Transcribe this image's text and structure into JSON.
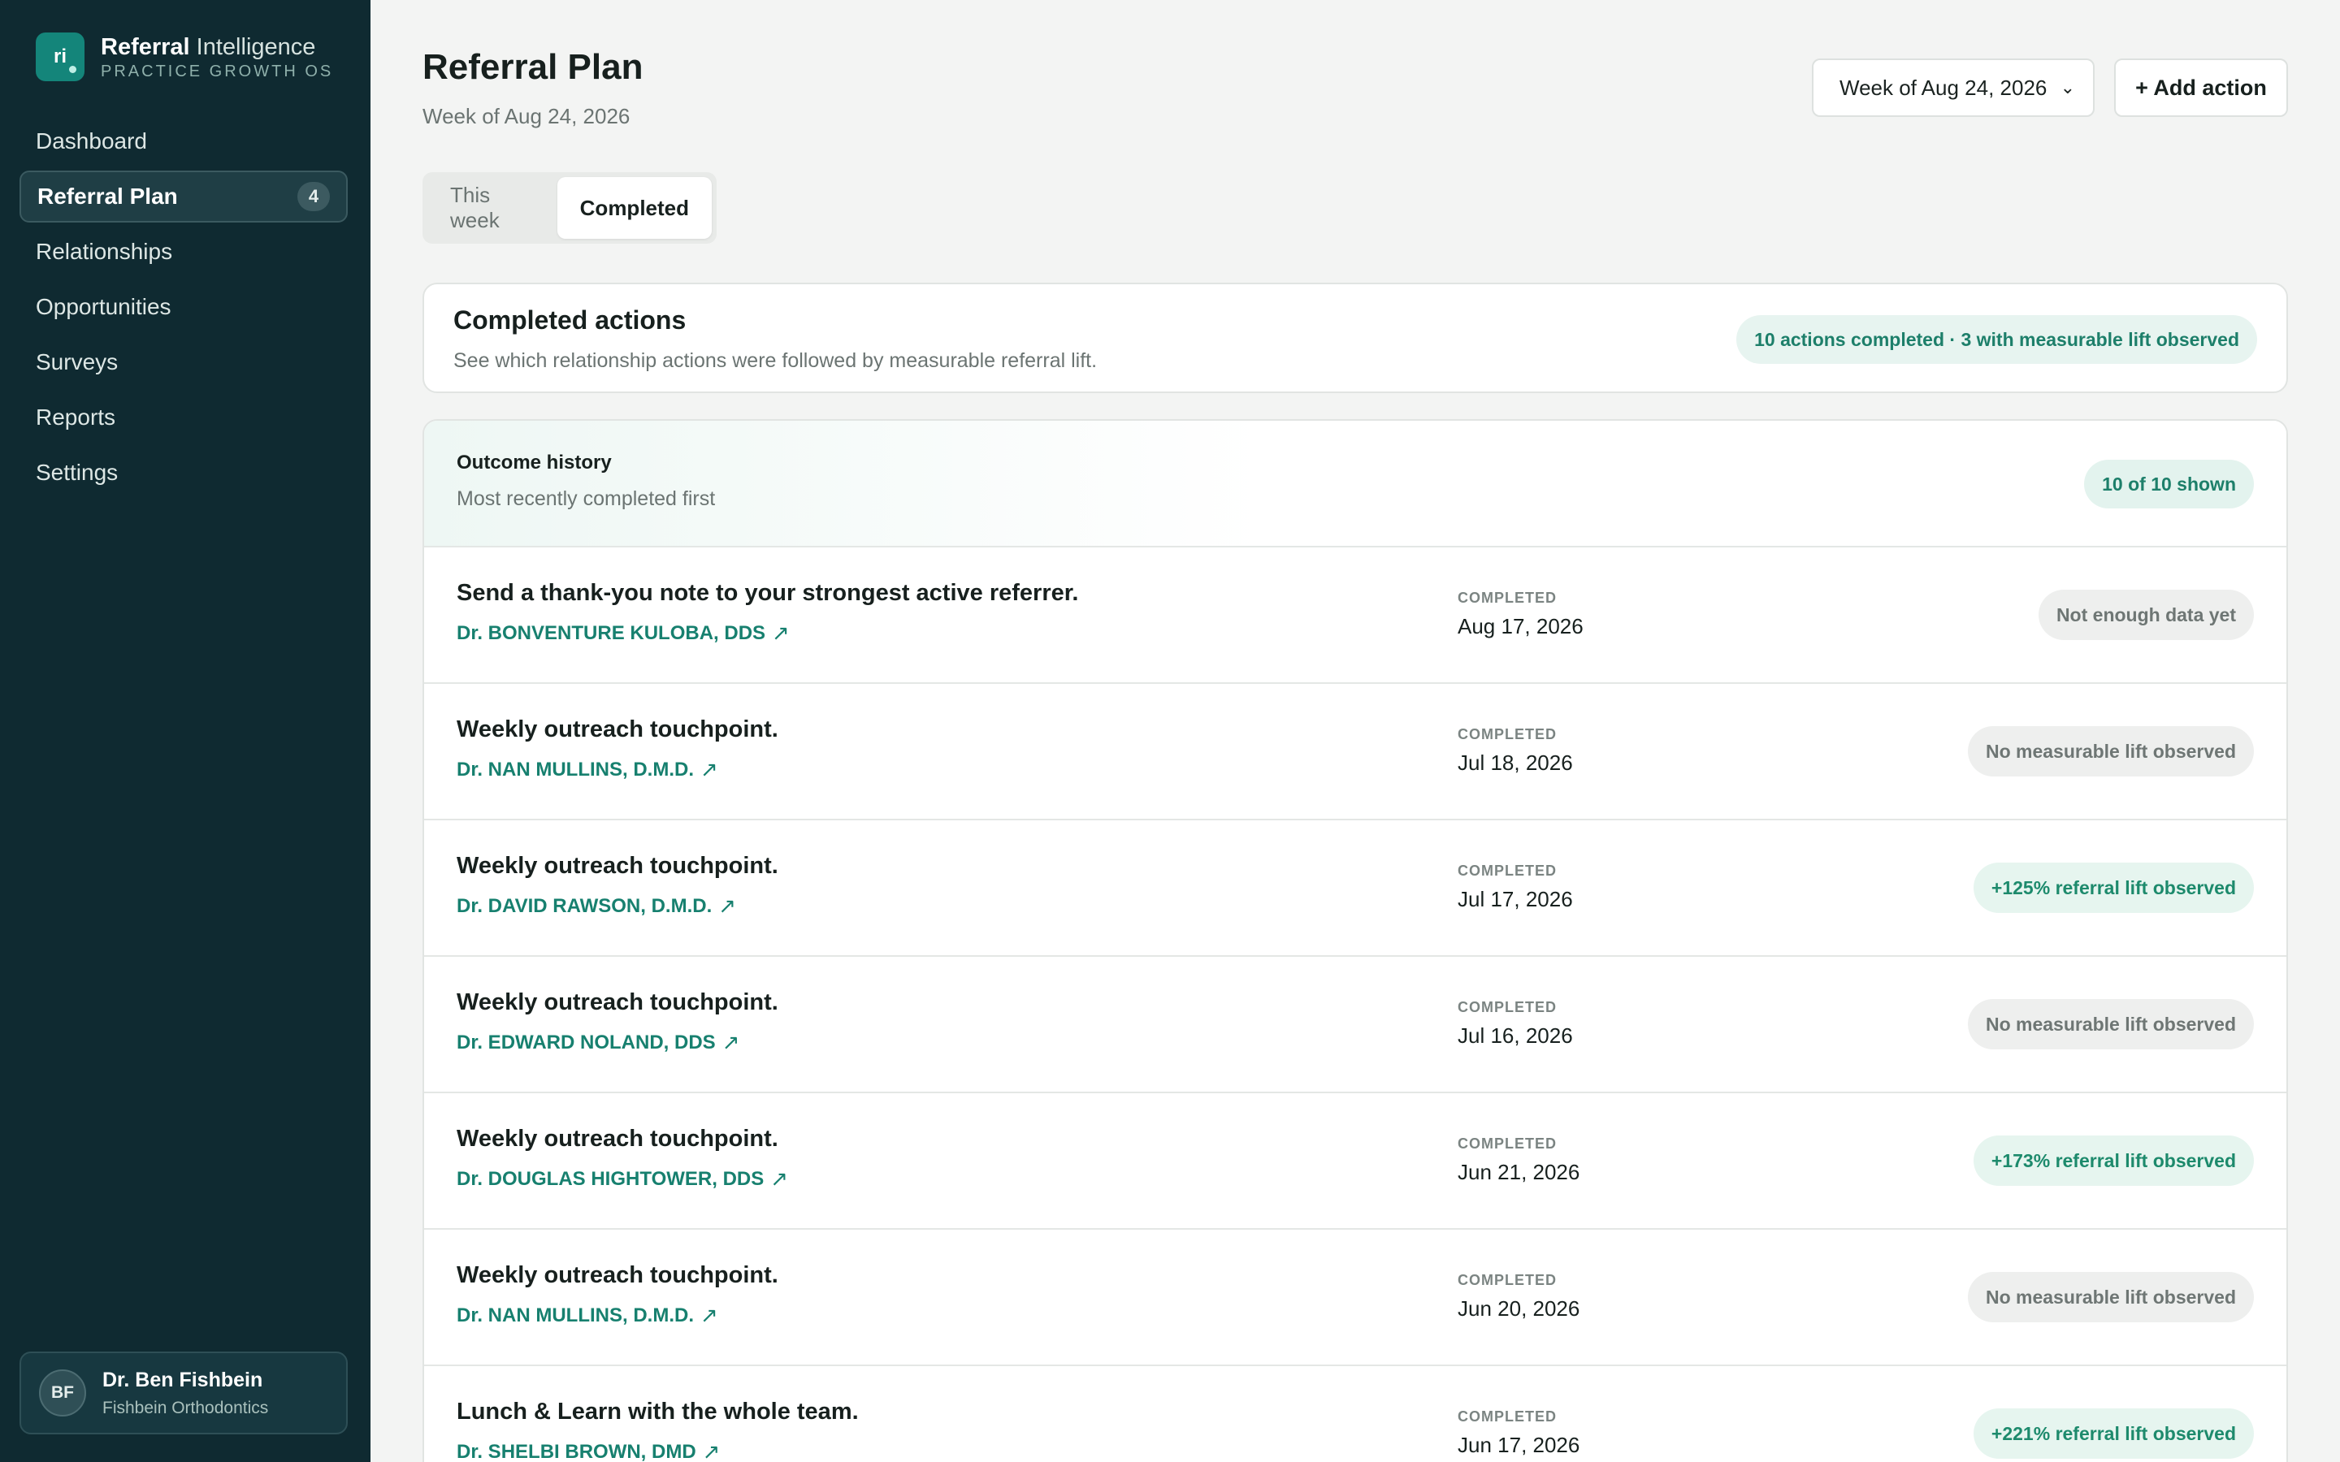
{
  "brand": {
    "logo_text": "ri",
    "name_bold": "Referral",
    "name_rest": " Intelligence",
    "tagline": "PRACTICE GROWTH OS"
  },
  "nav": [
    {
      "label": "Dashboard",
      "active": false
    },
    {
      "label": "Referral Plan",
      "active": true,
      "badge": "4"
    },
    {
      "label": "Relationships",
      "active": false
    },
    {
      "label": "Opportunities",
      "active": false
    },
    {
      "label": "Surveys",
      "active": false
    },
    {
      "label": "Reports",
      "active": false
    },
    {
      "label": "Settings",
      "active": false
    }
  ],
  "user": {
    "initials": "BF",
    "name": "Dr. Ben Fishbein",
    "org": "Fishbein Orthodontics"
  },
  "header": {
    "title": "Referral Plan",
    "subtitle": "Week of Aug 24, 2026",
    "week_select": "Week of Aug 24, 2026",
    "add_action": "+ Add action"
  },
  "tabs": [
    {
      "label": "This week",
      "active": false
    },
    {
      "label": "Completed",
      "active": true
    }
  ],
  "summary": {
    "title": "Completed actions",
    "description": "See which relationship actions were followed by measurable referral lift.",
    "pill": "10 actions completed · 3 with measurable lift observed"
  },
  "history": {
    "title": "Outcome history",
    "subtitle": "Most recently completed first",
    "count_pill": "10 of 10 shown",
    "completed_label": "COMPLETED",
    "rows": [
      {
        "action": "Send a thank-you note to your strongest active referrer.",
        "doctor": "Dr. BONVENTURE KULOBA, DDS",
        "date": "Aug 17, 2026",
        "status": "Not enough data yet",
        "tone": "neutral"
      },
      {
        "action": "Weekly outreach touchpoint.",
        "doctor": "Dr. NAN MULLINS, D.M.D.",
        "date": "Jul 18, 2026",
        "status": "No measurable lift observed",
        "tone": "neutral"
      },
      {
        "action": "Weekly outreach touchpoint.",
        "doctor": "Dr. DAVID RAWSON, D.M.D.",
        "date": "Jul 17, 2026",
        "status": "+125% referral lift observed",
        "tone": "positive"
      },
      {
        "action": "Weekly outreach touchpoint.",
        "doctor": "Dr. EDWARD NOLAND, DDS",
        "date": "Jul 16, 2026",
        "status": "No measurable lift observed",
        "tone": "neutral"
      },
      {
        "action": "Weekly outreach touchpoint.",
        "doctor": "Dr. DOUGLAS HIGHTOWER, DDS",
        "date": "Jun 21, 2026",
        "status": "+173% referral lift observed",
        "tone": "positive"
      },
      {
        "action": "Weekly outreach touchpoint.",
        "doctor": "Dr. NAN MULLINS, D.M.D.",
        "date": "Jun 20, 2026",
        "status": "No measurable lift observed",
        "tone": "neutral"
      },
      {
        "action": "Lunch & Learn with the whole team.",
        "doctor": "Dr. SHELBI BROWN, DMD",
        "date": "Jun 17, 2026",
        "status": "+221% referral lift observed",
        "tone": "positive"
      }
    ]
  },
  "colors": {
    "sidebar": "#0f2a31",
    "accent": "#14857a",
    "link": "#17806f",
    "positive": "#1d8a6c"
  }
}
